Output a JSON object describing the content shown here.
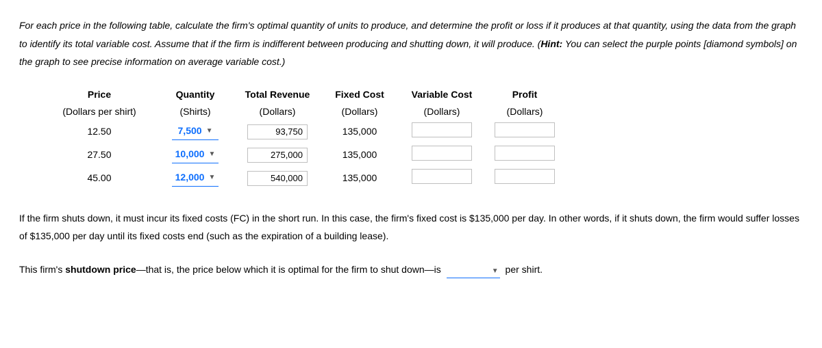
{
  "instructions": {
    "text_before_hint": "For each price in the following table, calculate the firm's optimal quantity of units to produce, and determine the profit or loss if it produces at that quantity, using the data from the graph to identify its total variable cost. Assume that if the firm is indifferent between producing and shutting down, it will produce. (",
    "hint_label": "Hint:",
    "hint_text": " You can select the purple points [diamond symbols] on the graph to see precise information on average variable cost.)"
  },
  "table": {
    "headers": {
      "price": "Price",
      "price_sub": "(Dollars per shirt)",
      "quantity": "Quantity",
      "quantity_sub": "(Shirts)",
      "revenue": "Total Revenue",
      "revenue_sub": "(Dollars)",
      "fixed_cost": "Fixed Cost",
      "fixed_cost_sub": "(Dollars)",
      "variable_cost": "Variable Cost",
      "variable_cost_sub": "(Dollars)",
      "profit": "Profit",
      "profit_sub": "(Dollars)"
    },
    "rows": [
      {
        "price": "12.50",
        "quantity": "7,500",
        "revenue": "93,750",
        "fixed_cost": "135,000",
        "variable_cost": "",
        "profit": ""
      },
      {
        "price": "27.50",
        "quantity": "10,000",
        "revenue": "275,000",
        "fixed_cost": "135,000",
        "variable_cost": "",
        "profit": ""
      },
      {
        "price": "45.00",
        "quantity": "12,000",
        "revenue": "540,000",
        "fixed_cost": "135,000",
        "variable_cost": "",
        "profit": ""
      }
    ]
  },
  "after_paragraph": "If the firm shuts down, it must incur its fixed costs (FC) in the short run. In this case, the firm's fixed cost is $135,000 per day. In other words, if it shuts down, the firm would suffer losses of $135,000 per day until its fixed costs end (such as the expiration of a building lease).",
  "shutdown": {
    "prefix": "This firm's ",
    "bold": "shutdown price",
    "middle": "—that is, the price below which it is optimal for the firm to shut down—is",
    "suffix": " per shirt."
  }
}
